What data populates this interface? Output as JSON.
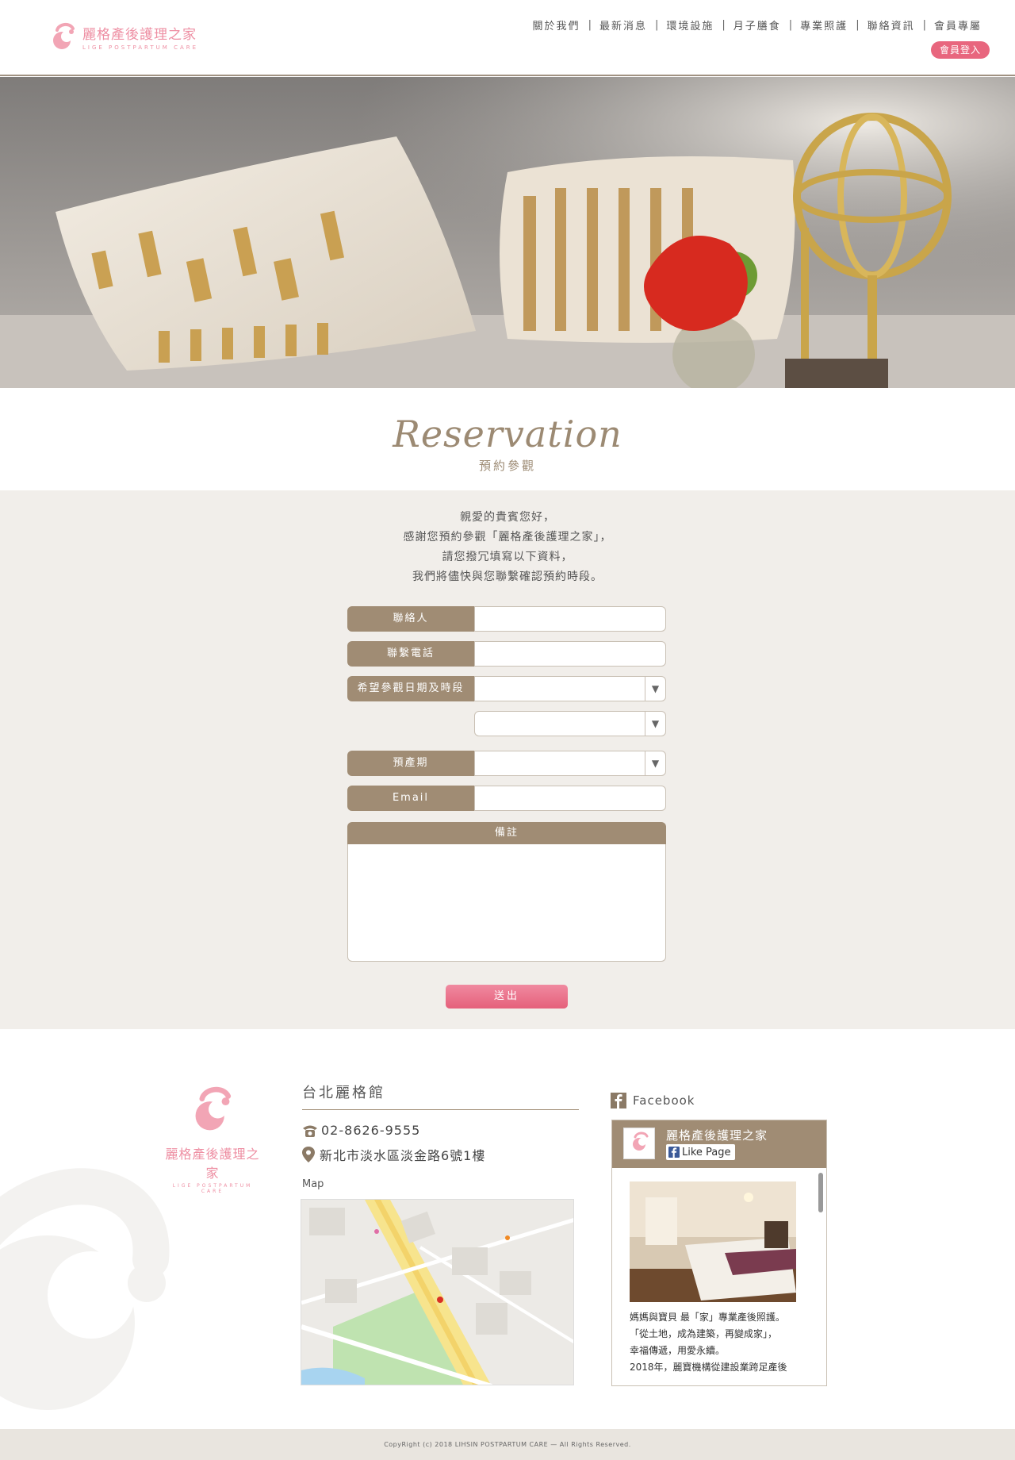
{
  "header": {
    "logo_cn": "麗格產後護理之家",
    "logo_en": "LIGE POSTPARTUM CARE",
    "nav": [
      "關於我們",
      "最新消息",
      "環境設施",
      "月子膳食",
      "專業照護",
      "聯絡資訊",
      "會員專屬"
    ],
    "login_label": "會員登入"
  },
  "section_title": {
    "script": "Reservation",
    "cn": "預約參觀"
  },
  "intro": [
    "親愛的貴賓您好，",
    "感謝您預約參觀「麗格產後護理之家」，",
    "請您撥冗填寫以下資料，",
    "我們將儘快與您聯繫確認預約時段。"
  ],
  "form": {
    "contact_label": "聯絡人",
    "phone_label": "聯繫電話",
    "visit_label": "希望參觀日期及時段",
    "due_label": "預產期",
    "email_label": "Email",
    "memo_label": "備註",
    "submit_label": "送出"
  },
  "footer": {
    "logo_cn": "麗格產後護理之家",
    "logo_en": "LIGE POSTPARTUM CARE",
    "branch_title": "台北麗格館",
    "phone": "02-8626-9555",
    "address": "新北市淡水區淡金路6號1樓",
    "map_label": "Map",
    "facebook_title": "Facebook",
    "fb_page_name": "麗格產後護理之家",
    "fb_like": "Like Page",
    "fb_text": [
      "媽媽與寶貝 最「家」專業產後照護。",
      "「從土地，成為建築，再變成家」，",
      "幸福傳遞，用愛永續。",
      "2018年，麗寶機構從建設業跨足產後"
    ]
  },
  "copyright": "CopyRight (c) 2018   LIHSIN POSTPARTUM CARE — All Rights Reserved.",
  "colors": {
    "brand_pink": "#e8667e",
    "label_brown": "#a08c74",
    "section_bg": "#f1eeea"
  }
}
